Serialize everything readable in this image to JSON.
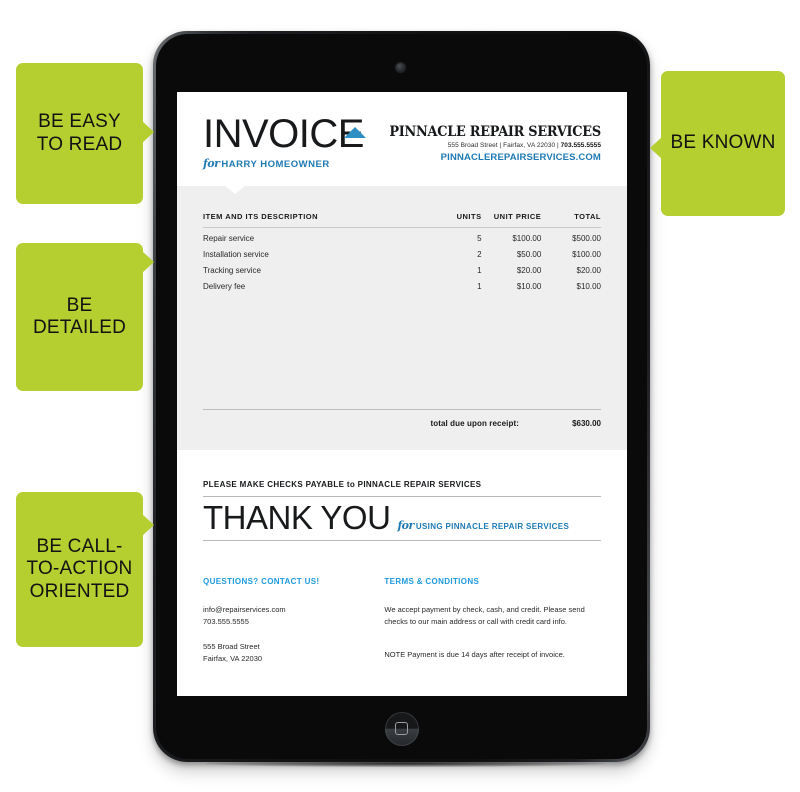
{
  "callouts": [
    {
      "id": "easy-to-read",
      "lines": [
        "BE EASY",
        "TO READ"
      ],
      "text": "BE EASY TO READ",
      "side": "left"
    },
    {
      "id": "detailed",
      "lines": [
        "BE",
        "DETAILED"
      ],
      "text": "BE DETAILED",
      "side": "left"
    },
    {
      "id": "call-to-action",
      "lines": [
        "BE",
        "CALL-TO-",
        "ACTION",
        "ORIENTED"
      ],
      "text": "BE CALL-TO-ACTION ORIENTED",
      "side": "left"
    },
    {
      "id": "known",
      "lines": [
        "BE",
        "KNOWN"
      ],
      "text": "BE KNOWN",
      "side": "right"
    }
  ],
  "colors": {
    "callout_green": "#b5ce30",
    "brand_blue": "#1e7ab4",
    "footer_heading_blue": "#1e9ade",
    "logo_blue": "#2e8fc2",
    "panel_grey": "#efefef",
    "device_black": "#0a0a0b"
  },
  "device": {
    "name": "tablet-device",
    "camera": "front-camera",
    "home_button": "home-button"
  },
  "invoice": {
    "title": "INVOICE",
    "for_prefix": "for",
    "for_name": "HARRY HOMEOWNER",
    "company": {
      "name": "PINNACLE REPAIR SERVICES",
      "address_street": "555 Broad Street | Fairfax, VA 22030 | ",
      "address_phone": "703.555.5555",
      "website": "PINNACLEREPAIRSERVICES.COM"
    },
    "table": {
      "headers": {
        "description": "ITEM AND ITS DESCRIPTION",
        "units": "UNITS",
        "unit_price": "UNIT PRICE",
        "total": "TOTAL"
      },
      "rows": [
        {
          "description": "Repair service",
          "units": "5",
          "unit_price": "$100.00",
          "total": "$500.00"
        },
        {
          "description": "Installation service",
          "units": "2",
          "unit_price": "$50.00",
          "total": "$100.00"
        },
        {
          "description": "Tracking service",
          "units": "1",
          "unit_price": "$20.00",
          "total": "$20.00"
        },
        {
          "description": "Delivery fee",
          "units": "1",
          "unit_price": "$10.00",
          "total": "$10.00"
        }
      ],
      "total_label": "total due upon receipt:",
      "total_amount": "$630.00"
    },
    "checks_payable": "PLEASE MAKE CHECKS PAYABLE to PINNACLE REPAIR SERVICES",
    "thank_you": "THANK YOU",
    "thank_you_prefix": "for",
    "thank_you_sub": "USING PINNACLE REPAIR SERVICES",
    "footer": {
      "contact_heading": "QUESTIONS? CONTACT US!",
      "contact_email": "info@repairservices.com",
      "contact_phone": "703.555.5555",
      "contact_street": "555 Broad Street",
      "contact_city": "Fairfax, VA 22030",
      "terms_heading": "TERMS & CONDITIONS",
      "terms_body": "We accept payment by check, cash, and credit. Please send checks to our main address or call with credit card info.",
      "terms_note": "NOTE  Payment is due 14 days after receipt of invoice."
    }
  }
}
